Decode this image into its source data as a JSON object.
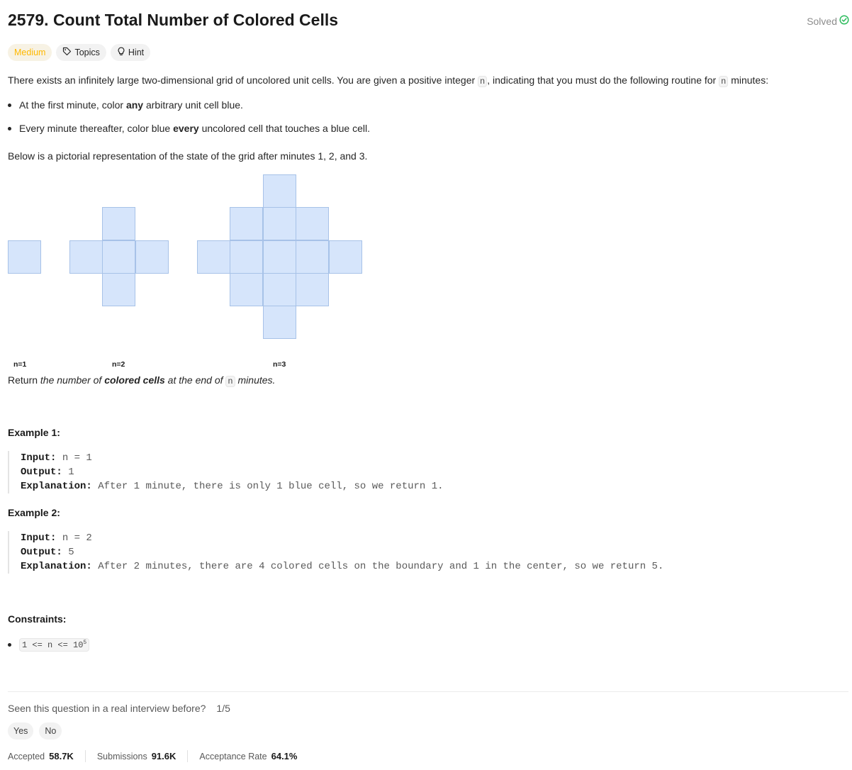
{
  "problem": {
    "title": "2579. Count Total Number of Colored Cells",
    "status": "Solved",
    "difficulty": "Medium",
    "topics_label": "Topics",
    "hint_label": "Hint"
  },
  "description": {
    "intro_1": "There exists an infinitely large two-dimensional grid of uncolored unit cells. You are given a positive integer ",
    "intro_code_1": "n",
    "intro_2": ", indicating that you must do the following routine for ",
    "intro_code_2": "n",
    "intro_3": " minutes:",
    "bullet1": {
      "pre": "At the first minute, color ",
      "bold": "any",
      "post": " arbitrary unit cell blue."
    },
    "bullet2": {
      "pre": "Every minute thereafter, color blue ",
      "bold": "every",
      "post": " uncolored cell that touches a blue cell."
    },
    "below": "Below is a pictorial representation of the state of the grid after minutes 1, 2, and 3.",
    "figure_labels": [
      "n=1",
      "n=2",
      "n=3"
    ],
    "return": {
      "pre": "Return ",
      "it1": "the number of ",
      "bold": "colored cells",
      "it2": " at the end of ",
      "code": "n",
      "it3": " minutes."
    }
  },
  "examples": [
    {
      "heading": "Example 1:",
      "input_label": "Input:",
      "input": "n = 1",
      "output_label": "Output:",
      "output": "1",
      "explanation_label": "Explanation:",
      "explanation": "After 1 minute, there is only 1 blue cell, so we return 1."
    },
    {
      "heading": "Example 2:",
      "input_label": "Input:",
      "input": "n = 2",
      "output_label": "Output:",
      "output": "5",
      "explanation_label": "Explanation:",
      "explanation": "After 2 minutes, there are 4 colored cells on the boundary and 1 in the center, so we return 5."
    }
  ],
  "constraints": {
    "heading": "Constraints:",
    "item_base": "1 <= n <= 10",
    "item_exp": "5"
  },
  "interview": {
    "question": "Seen this question in a real interview before?",
    "count": "1/5",
    "yes": "Yes",
    "no": "No"
  },
  "stats": {
    "accepted_label": "Accepted",
    "accepted": "58.7K",
    "submissions_label": "Submissions",
    "submissions": "91.6K",
    "rate_label": "Acceptance Rate",
    "rate": "64.1%"
  },
  "colors": {
    "cell_fill": "#d6e5fb",
    "cell_border": "#a7c2e8",
    "medium": "#ffb800",
    "solved_check": "#2cbb5d"
  }
}
